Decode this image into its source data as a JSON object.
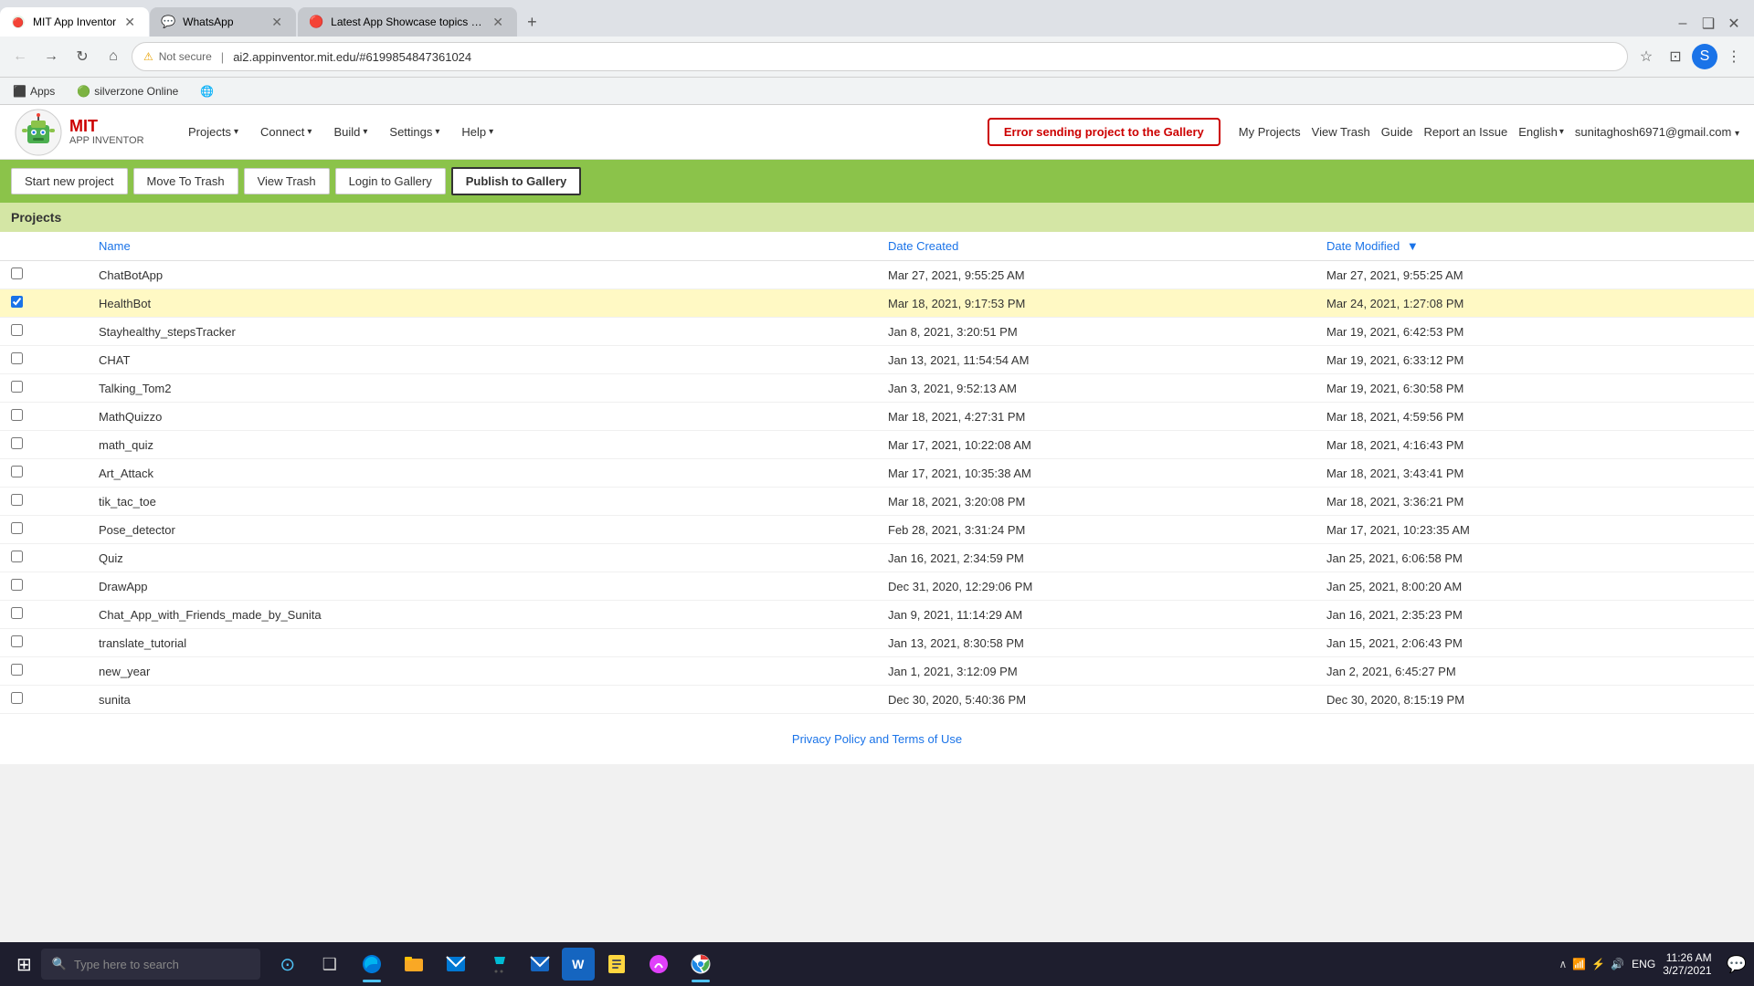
{
  "browser": {
    "tabs": [
      {
        "id": "tab1",
        "title": "MIT App Inventor",
        "url": "ai2.appinventor.mit.edu/#6199854847361024",
        "active": true,
        "favicon": "🔴"
      },
      {
        "id": "tab2",
        "title": "WhatsApp",
        "url": "web.whatsapp.com",
        "active": false,
        "favicon": "💬"
      },
      {
        "id": "tab3",
        "title": "Latest App Showcase topics - M...",
        "url": "appinventor.mit.edu",
        "active": false,
        "favicon": "🔴"
      }
    ],
    "address": "ai2.appinventor.mit.edu/#6199854847361024",
    "security_label": "Not secure"
  },
  "bookmarks": [
    {
      "label": "Apps",
      "icon": "⬛"
    },
    {
      "label": "silverzone Online",
      "icon": "🟢"
    }
  ],
  "app_header": {
    "logo_mit": "MIT",
    "logo_subtitle": "APP INVENTOR",
    "nav": [
      {
        "label": "Projects",
        "has_arrow": true
      },
      {
        "label": "Connect",
        "has_arrow": true
      },
      {
        "label": "Build",
        "has_arrow": true
      },
      {
        "label": "Settings",
        "has_arrow": true
      },
      {
        "label": "Help",
        "has_arrow": true
      }
    ],
    "error_message": "Error sending project to the Gallery",
    "right_links": [
      {
        "label": "My Projects"
      },
      {
        "label": "View Trash"
      },
      {
        "label": "Guide"
      },
      {
        "label": "Report an Issue"
      },
      {
        "label": "English",
        "has_arrow": true
      },
      {
        "label": "sunitaghosh6971@gmail.com",
        "has_arrow": true
      }
    ]
  },
  "toolbar": {
    "buttons": [
      {
        "label": "Start new project",
        "active": false
      },
      {
        "label": "Move To Trash",
        "active": false
      },
      {
        "label": "View Trash",
        "active": false
      },
      {
        "label": "Login to Gallery",
        "active": false
      },
      {
        "label": "Publish to Gallery",
        "active": true
      }
    ]
  },
  "projects_section": {
    "header": "Projects",
    "columns": [
      {
        "label": "Name",
        "sortable": false
      },
      {
        "label": "Date Created",
        "sortable": false
      },
      {
        "label": "Date Modified",
        "sortable": true,
        "sort_dir": "desc"
      }
    ],
    "rows": [
      {
        "name": "ChatBotApp",
        "date_created": "Mar 27, 2021, 9:55:25 AM",
        "date_modified": "Mar 27, 2021, 9:55:25 AM",
        "selected": false
      },
      {
        "name": "HealthBot",
        "date_created": "Mar 18, 2021, 9:17:53 PM",
        "date_modified": "Mar 24, 2021, 1:27:08 PM",
        "selected": true
      },
      {
        "name": "Stayhealthy_stepsTracker",
        "date_created": "Jan 8, 2021, 3:20:51 PM",
        "date_modified": "Mar 19, 2021, 6:42:53 PM",
        "selected": false
      },
      {
        "name": "CHAT",
        "date_created": "Jan 13, 2021, 11:54:54 AM",
        "date_modified": "Mar 19, 2021, 6:33:12 PM",
        "selected": false
      },
      {
        "name": "Talking_Tom2",
        "date_created": "Jan 3, 2021, 9:52:13 AM",
        "date_modified": "Mar 19, 2021, 6:30:58 PM",
        "selected": false
      },
      {
        "name": "MathQuizzo",
        "date_created": "Mar 18, 2021, 4:27:31 PM",
        "date_modified": "Mar 18, 2021, 4:59:56 PM",
        "selected": false
      },
      {
        "name": "math_quiz",
        "date_created": "Mar 17, 2021, 10:22:08 AM",
        "date_modified": "Mar 18, 2021, 4:16:43 PM",
        "selected": false
      },
      {
        "name": "Art_Attack",
        "date_created": "Mar 17, 2021, 10:35:38 AM",
        "date_modified": "Mar 18, 2021, 3:43:41 PM",
        "selected": false
      },
      {
        "name": "tik_tac_toe",
        "date_created": "Mar 18, 2021, 3:20:08 PM",
        "date_modified": "Mar 18, 2021, 3:36:21 PM",
        "selected": false
      },
      {
        "name": "Pose_detector",
        "date_created": "Feb 28, 2021, 3:31:24 PM",
        "date_modified": "Mar 17, 2021, 10:23:35 AM",
        "selected": false
      },
      {
        "name": "Quiz",
        "date_created": "Jan 16, 2021, 2:34:59 PM",
        "date_modified": "Jan 25, 2021, 6:06:58 PM",
        "selected": false
      },
      {
        "name": "DrawApp",
        "date_created": "Dec 31, 2020, 12:29:06 PM",
        "date_modified": "Jan 25, 2021, 8:00:20 AM",
        "selected": false
      },
      {
        "name": "Chat_App_with_Friends_made_by_Sunita",
        "date_created": "Jan 9, 2021, 11:14:29 AM",
        "date_modified": "Jan 16, 2021, 2:35:23 PM",
        "selected": false
      },
      {
        "name": "translate_tutorial",
        "date_created": "Jan 13, 2021, 8:30:58 PM",
        "date_modified": "Jan 15, 2021, 2:06:43 PM",
        "selected": false
      },
      {
        "name": "new_year",
        "date_created": "Jan 1, 2021, 3:12:09 PM",
        "date_modified": "Jan 2, 2021, 6:45:27 PM",
        "selected": false
      },
      {
        "name": "sunita",
        "date_created": "Dec 30, 2020, 5:40:36 PM",
        "date_modified": "Dec 30, 2020, 8:15:19 PM",
        "selected": false
      }
    ]
  },
  "footer": {
    "label": "Privacy Policy and Terms of Use"
  },
  "taskbar": {
    "search_placeholder": "Type here to search",
    "clock_time": "11:26 AM",
    "clock_date": "3/27/2021",
    "lang": "ENG",
    "apps": [
      {
        "name": "windows-start",
        "icon": "⊞"
      },
      {
        "name": "cortana",
        "icon": "⊙"
      },
      {
        "name": "task-view",
        "icon": "❑"
      },
      {
        "name": "edge",
        "icon": "e"
      },
      {
        "name": "file-explorer",
        "icon": "📁"
      },
      {
        "name": "email",
        "icon": "✉"
      },
      {
        "name": "store",
        "icon": "🛍"
      },
      {
        "name": "mail2",
        "icon": "📧"
      },
      {
        "name": "word",
        "icon": "W"
      },
      {
        "name": "notes",
        "icon": "📝"
      },
      {
        "name": "browser2",
        "icon": "🌐"
      },
      {
        "name": "chrome",
        "icon": "●"
      }
    ]
  }
}
